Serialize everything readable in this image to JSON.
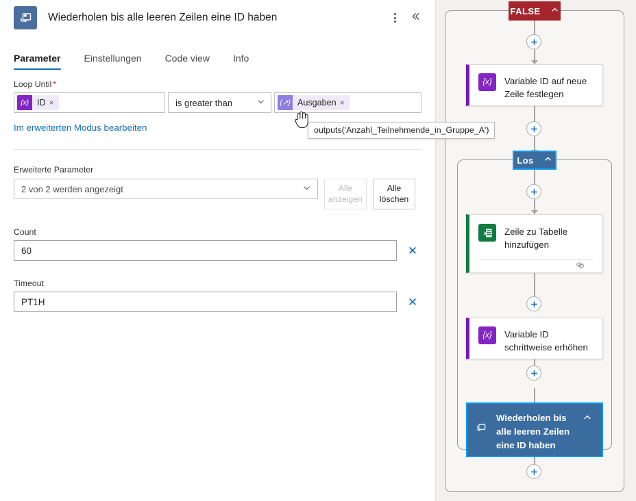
{
  "panel": {
    "icon_name": "until-loop-icon",
    "title": "Wiederholen bis alle leeren Zeilen eine ID haben",
    "more_label": "more-options",
    "collapse_label": "collapse-panel",
    "tabs": [
      {
        "label": "Parameter",
        "active": true
      },
      {
        "label": "Einstellungen",
        "active": false
      },
      {
        "label": "Code view",
        "active": false
      },
      {
        "label": "Info",
        "active": false
      }
    ],
    "loop_until": {
      "label": "Loop Until",
      "required_mark": "*",
      "left_token": {
        "icon": "{x}",
        "text": "ID",
        "remove": "×"
      },
      "operator": "is greater than",
      "right_token": {
        "icon": "{↗}",
        "text": "Ausgaben",
        "remove": "×"
      },
      "advanced_link": "Im erweiterten Modus bearbeiten"
    },
    "tooltip": "outputs('Anzahl_Teilnehmende_in_Gruppe_A')",
    "advanced": {
      "label": "Erweiterte Parameter",
      "select_value": "2 von 2 werden angezeigt",
      "show_all": "Alle anzeigen",
      "clear_all": "Alle löschen"
    },
    "params": [
      {
        "label": "Count",
        "value": "60",
        "clear": "✕"
      },
      {
        "label": "Timeout",
        "value": "PT1H",
        "clear": "✕"
      }
    ]
  },
  "canvas": {
    "false_badge": "FALSE",
    "los_badge": "Los",
    "add_label": "+",
    "nodes": [
      {
        "id": "set-var",
        "title": "Variable ID auf neue Zeile festlegen",
        "icon": "{x}",
        "kind": "variable"
      },
      {
        "id": "add-row",
        "title": "Zeile zu Tabelle hinzufügen",
        "icon": "excel",
        "kind": "excel"
      },
      {
        "id": "inc-var",
        "title": "Variable ID schrittweise erhöhen",
        "icon": "{x}",
        "kind": "variable"
      },
      {
        "id": "until-loop",
        "title": "Wiederholen bis alle leeren Zeilen eine ID haben",
        "icon": "until-loop",
        "kind": "selected"
      }
    ]
  },
  "colors": {
    "accent": "#0f6cbd",
    "false_red": "#a4262c",
    "selected_blue": "#3b6ca0",
    "selection_outline": "#0f9bf0",
    "variable_purple": "#8324c4",
    "excel_green": "#107c41"
  }
}
